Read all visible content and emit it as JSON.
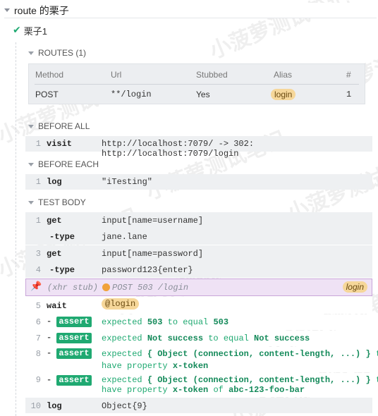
{
  "suite": {
    "title": "route 的栗子"
  },
  "test": {
    "title": "栗子1"
  },
  "routes_section": {
    "heading": "ROUTES (1)",
    "columns": [
      "Method",
      "Url",
      "Stubbed",
      "Alias",
      "#"
    ],
    "rows": [
      {
        "method": "POST",
        "url": "**/login",
        "stubbed": "Yes",
        "alias": "login",
        "count": "1"
      }
    ]
  },
  "before_all": {
    "heading": "BEFORE ALL",
    "commands": [
      {
        "num": "1",
        "name": "visit",
        "message": "http://localhost:7079/ -> 302: http://localhost:7079/login"
      }
    ]
  },
  "before_each": {
    "heading": "BEFORE EACH",
    "commands": [
      {
        "num": "1",
        "name": "log",
        "message": "\"iTesting\""
      }
    ]
  },
  "test_body": {
    "heading": "TEST BODY",
    "commands": [
      {
        "num": "1",
        "name": "get",
        "message": "input[name=username]"
      },
      {
        "num": "",
        "name": "-type",
        "message": "jane.lane"
      },
      {
        "num": "3",
        "name": "get",
        "message": "input[name=password]"
      },
      {
        "num": "4",
        "name": "-type",
        "message": "password123{enter}"
      }
    ],
    "xhr": {
      "label": "(xhr stub)",
      "request": "POST 503 /login",
      "alias": "login"
    },
    "wait": {
      "num": "5",
      "name": "wait",
      "alias": "@login"
    },
    "asserts": [
      {
        "num": "6",
        "dash": "-",
        "badge": "assert",
        "w1": "expected",
        "v1": "503",
        "w2": "to equal",
        "v2": "503"
      },
      {
        "num": "7",
        "dash": "-",
        "badge": "assert",
        "w1": "expected",
        "v1": "Not success",
        "w2": "to equal",
        "v2": "Not success"
      },
      {
        "num": "8",
        "dash": "-",
        "badge": "assert",
        "w1": "expected",
        "v1": "{ Object (connection, content-length, ...) }",
        "w2": "to",
        "line2a": "have property",
        "line2b": "x-token"
      },
      {
        "num": "9",
        "dash": "-",
        "badge": "assert",
        "w1": "expected",
        "v1": "{ Object (connection, content-length, ...) }",
        "w2": "to",
        "line2a": "have property",
        "line2b": "x-token",
        "line2c": "of",
        "line2d": "abc-123-foo-bar"
      }
    ],
    "last": {
      "num": "10",
      "name": "log",
      "message": "Object{9}"
    }
  },
  "watermark": "小菠萝测试笔记",
  "colors": {
    "assert_green": "#1fa971",
    "alias_orange": "#f6d79a",
    "xhr_purple": "#efe2f5"
  }
}
